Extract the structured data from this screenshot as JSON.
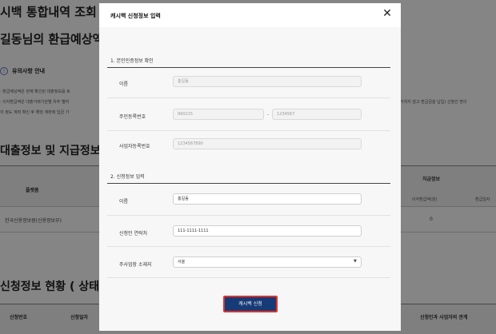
{
  "background": {
    "page_title": "시백 통합내역 조회",
    "greeting": "길동님의 환급예상액은",
    "notice": {
      "title": "유의사항 안내",
      "lines": [
        "· 환급예상액은 현재 확인된 대출정보를 토",
        "· 이자환급액은 대출거래기관별 차주 별여",
        "  의 정도 계좌 확인 후 해당 계좌에 입금 가"
      ],
      "right_text": "거치지 않고 환급금을 납입) 신청인 명의"
    },
    "section_loan": "대출정보 및 지급정보",
    "table": {
      "col_platform": "플랫폼",
      "col_payment_group": "지급정보",
      "col_interest": "이자환급액(원)",
      "col_date": "환급일자",
      "row_platform": "한국신용정보원(신용정보부)",
      "row_interest": "0"
    },
    "section_status": "신청정보 현황 ( 상태",
    "status_cols": [
      "신청번호",
      "신청일자",
      "신청인과 사업자의 관계"
    ]
  },
  "modal": {
    "title": "캐시백 신청정보 입력",
    "close_icon": "close-icon",
    "section1": {
      "title": "1. 본인인증정보 확인",
      "name_label": "이름",
      "name_value": "홍길동",
      "rrn_label": "주민등록번호",
      "rrn_front": "990215",
      "rrn_sep": "-",
      "rrn_back": "1234567",
      "biz_label": "사업자등록번호",
      "biz_value": "1234567890"
    },
    "section2": {
      "title": "2. 신청정보 입력",
      "name_label": "이름",
      "name_value": "홍길동",
      "phone_label": "신청인 연락처",
      "phone_value": "111-1111-1111",
      "region_label": "주사업장 소재지",
      "region_value": "서울"
    },
    "submit_label": "캐시백 신청"
  }
}
